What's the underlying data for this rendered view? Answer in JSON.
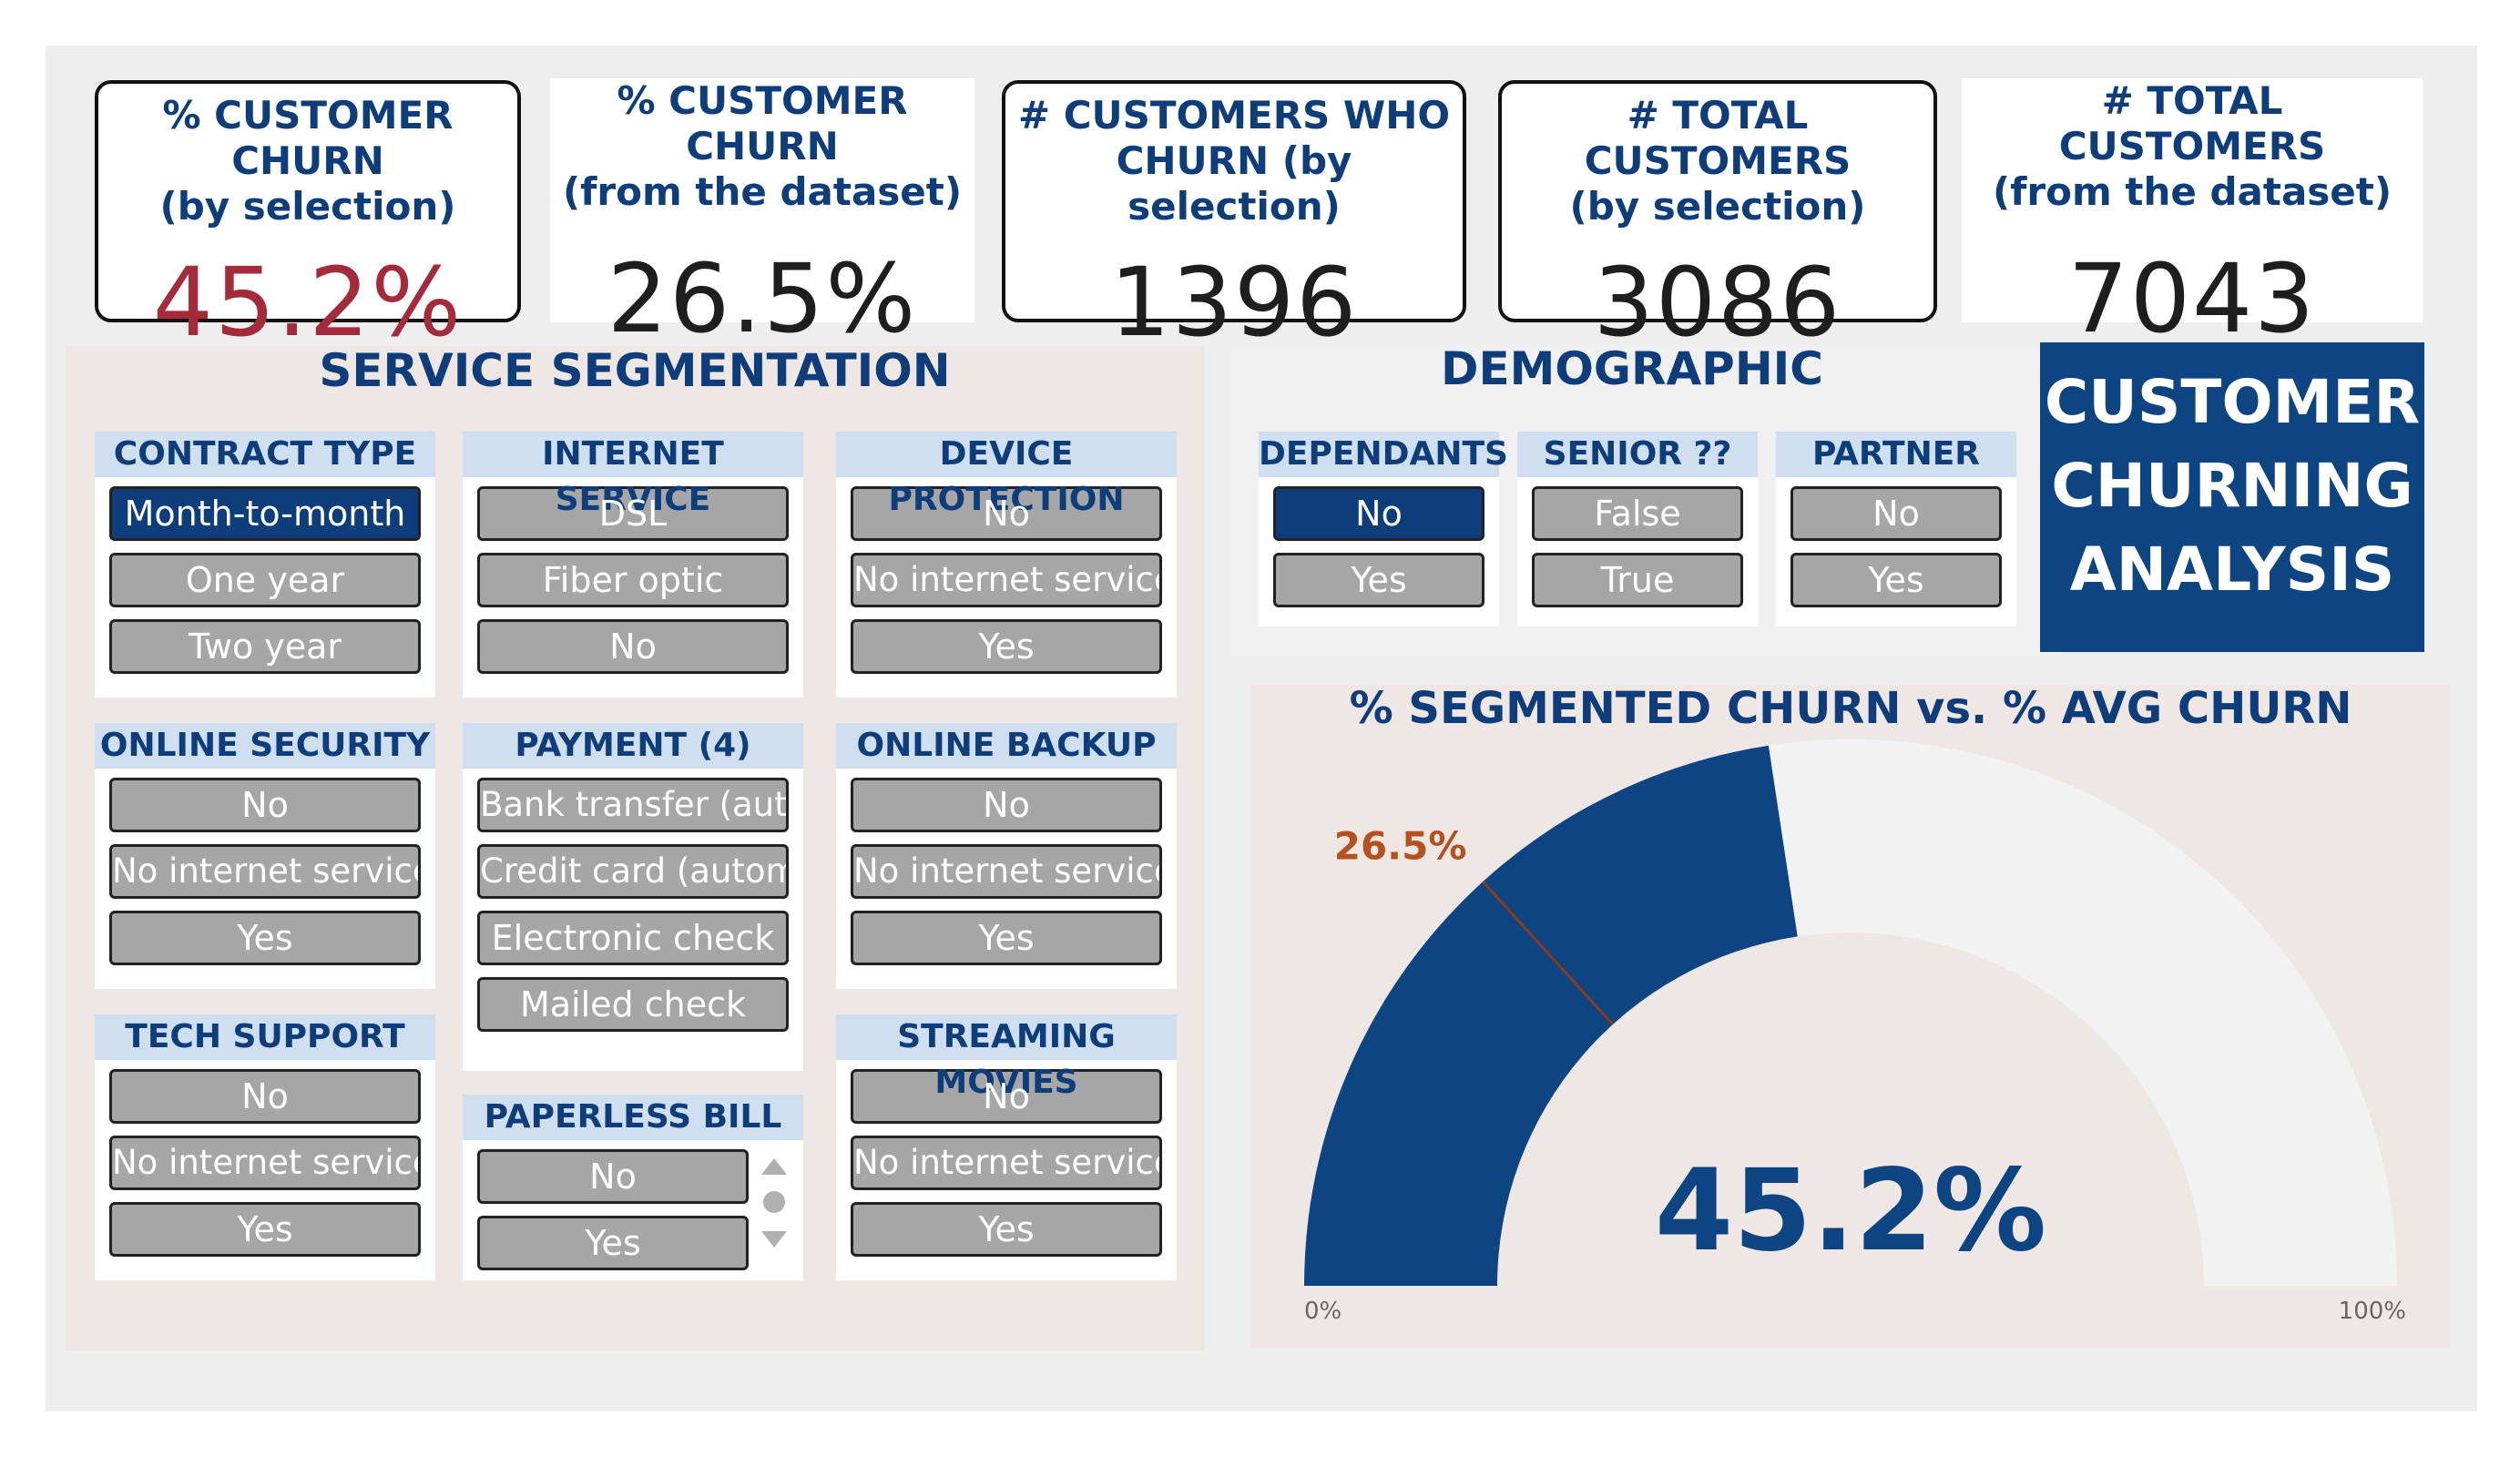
{
  "kpis": [
    {
      "title_l1": "% CUSTOMER CHURN",
      "title_l2": "(by selection)",
      "value": "45.2%"
    },
    {
      "title_l1": "% CUSTOMER CHURN",
      "title_l2": "(from the dataset)",
      "value": "26.5%"
    },
    {
      "title_l1": "# CUSTOMERS WHO",
      "title_l2": "CHURN (by selection)",
      "value": "1396"
    },
    {
      "title_l1": "# TOTAL CUSTOMERS",
      "title_l2": "(by selection)",
      "value": "3086"
    },
    {
      "title_l1": "# TOTAL CUSTOMERS",
      "title_l2": "(from the dataset)",
      "value": "7043"
    }
  ],
  "service": {
    "title": "SERVICE SEGMENTATION",
    "contract": {
      "header": "CONTRACT TYPE",
      "options": [
        "Month-to-month",
        "One year",
        "Two year"
      ]
    },
    "internet": {
      "header": "INTERNET SERVICE",
      "options": [
        "DSL",
        "Fiber optic",
        "No"
      ]
    },
    "device": {
      "header": "DEVICE PROTECTION",
      "options": [
        "No",
        "No internet service",
        "Yes"
      ]
    },
    "security": {
      "header": "ONLINE SECURITY",
      "options": [
        "No",
        "No internet service",
        "Yes"
      ]
    },
    "payment": {
      "header": "PAYMENT (4)",
      "options": [
        "Bank transfer (auto",
        "Credit card (automa",
        "Electronic check",
        "Mailed check"
      ]
    },
    "backup": {
      "header": "ONLINE BACKUP",
      "options": [
        "No",
        "No internet service",
        "Yes"
      ]
    },
    "tech": {
      "header": "TECH SUPPORT",
      "options": [
        "No",
        "No internet service",
        "Yes"
      ]
    },
    "paperless": {
      "header": "PAPERLESS BILL",
      "options": [
        "No",
        "Yes"
      ]
    },
    "movies": {
      "header": "STREAMING MOVIES",
      "options": [
        "No",
        "No internet service",
        "Yes"
      ]
    }
  },
  "demographic": {
    "title": "DEMOGRAPHIC",
    "dependants": {
      "header": "DEPENDANTS",
      "options": [
        "No",
        "Yes"
      ]
    },
    "senior": {
      "header": "SENIOR ??",
      "options": [
        "False",
        "True"
      ]
    },
    "partner": {
      "header": "PARTNER",
      "options": [
        "No",
        "Yes"
      ]
    }
  },
  "report_title": {
    "l1": "CUSTOMER",
    "l2": "CHURNING",
    "l3": "ANALYSIS"
  },
  "gauge": {
    "title": "% SEGMENTED CHURN vs. % AVG CHURN",
    "value": 45.2,
    "value_label": "45.2%",
    "target": 26.5,
    "target_label": "26.5%",
    "min_label": "0%",
    "max_label": "100%",
    "colors": {
      "fill": "#0d4583",
      "track": "#f2f2f2",
      "target": "#8b3a1a"
    }
  },
  "colors": {
    "accent": "#0d3d7a",
    "churn_red": "#a52a3a",
    "header_bg": "#cfdff0",
    "option_bg": "#a6a6a6"
  }
}
